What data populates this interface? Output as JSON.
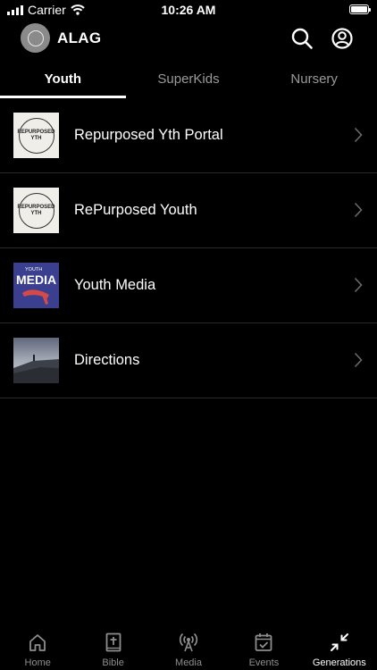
{
  "status": {
    "carrier": "Carrier",
    "time": "10:26 AM"
  },
  "header": {
    "title": "ALAG",
    "logo_icon": "church-logo-icon"
  },
  "tabs": [
    {
      "label": "Youth",
      "active": true
    },
    {
      "label": "SuperKids",
      "active": false
    },
    {
      "label": "Nursery",
      "active": false
    }
  ],
  "list": [
    {
      "label": "Repurposed Yth Portal",
      "thumb_text": "REPURPOSED YTH"
    },
    {
      "label": "RePurposed Youth",
      "thumb_text": "REPURPOSED YTH"
    },
    {
      "label": "Youth Media",
      "thumb_small": "YOUTH",
      "thumb_big": "MEDIA"
    },
    {
      "label": "Directions"
    }
  ],
  "tabbar": [
    {
      "label": "Home",
      "icon": "home-icon"
    },
    {
      "label": "Bible",
      "icon": "bible-icon"
    },
    {
      "label": "Media",
      "icon": "broadcast-icon"
    },
    {
      "label": "Events",
      "icon": "calendar-icon"
    },
    {
      "label": "Generations",
      "icon": "collapse-arrows-icon",
      "active": true
    }
  ]
}
